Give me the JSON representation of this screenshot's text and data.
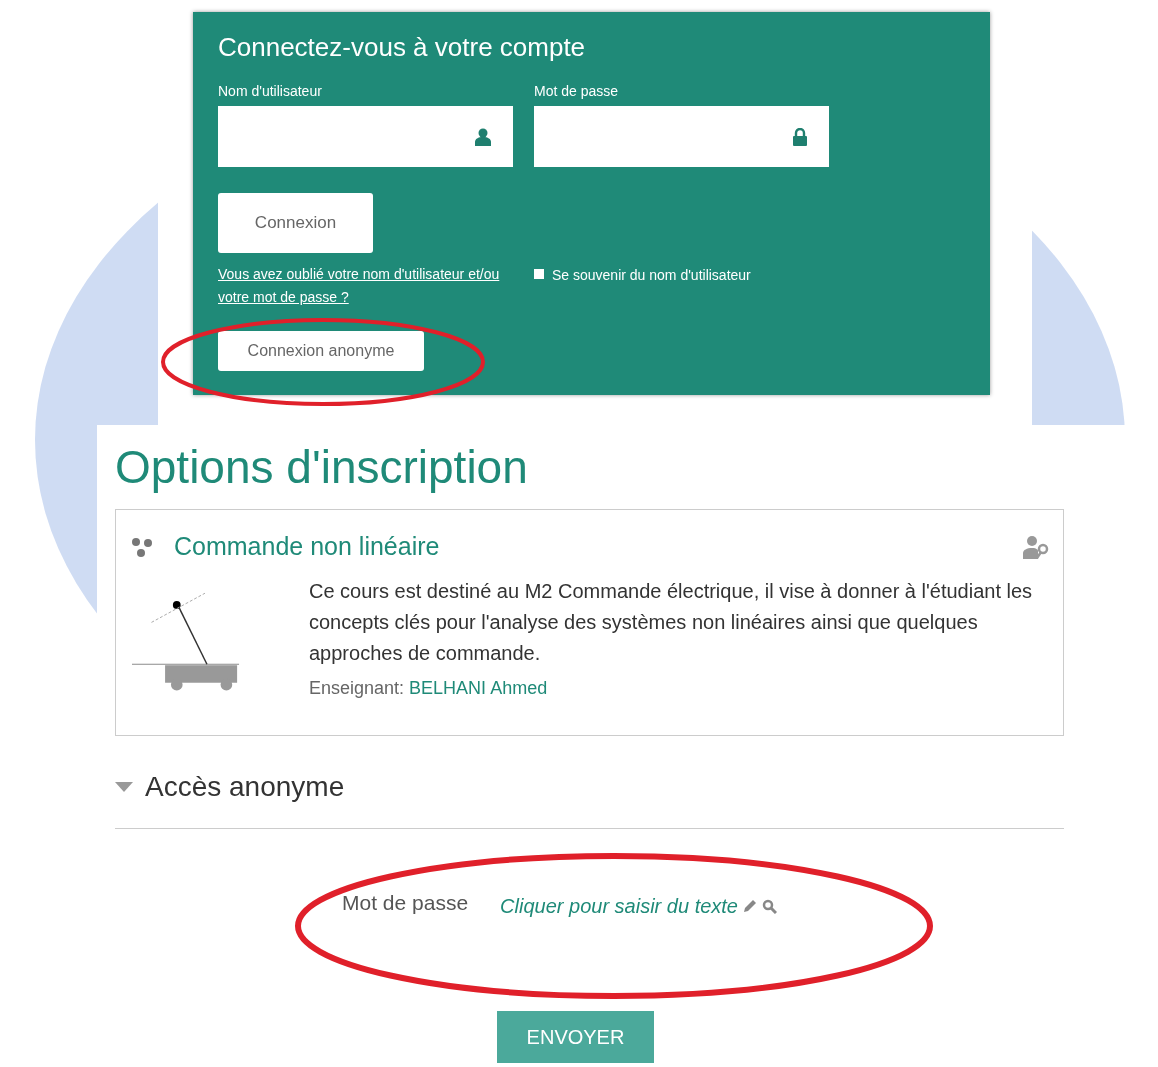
{
  "login": {
    "title": "Connectez-vous à votre compte",
    "fields": [
      {
        "label": "Nom d'utilisateur",
        "kind": "user"
      },
      {
        "label": "Mot de passe",
        "kind": "lock"
      }
    ],
    "submit": "Connexion",
    "forgot_link": "Vous avez oublié votre nom d'utilisateur et/ou votre mot de passe ?",
    "remember": {
      "label": "Se souvenir du nom d'utilisateur",
      "checked": false
    },
    "guest_button": "Connexion anonyme"
  },
  "enrol": {
    "title": "Options d'inscription",
    "course": {
      "name": "Commande non linéaire",
      "summary": "Ce cours est destiné au M2 Commande électrique, il vise à donner à l'étudiant les concepts clés pour l'analyse des systèmes non linéaires ainsi que quelques approches de commande.",
      "teacher_label": "Enseignant:",
      "teacher": "BELHANI Ahmed"
    },
    "section": {
      "title": "Accès anonyme",
      "expanded": true
    },
    "password": {
      "label": "Mot de passe",
      "placeholder": "Cliquer pour saisir du texte"
    },
    "submit": "ENVOYER"
  }
}
